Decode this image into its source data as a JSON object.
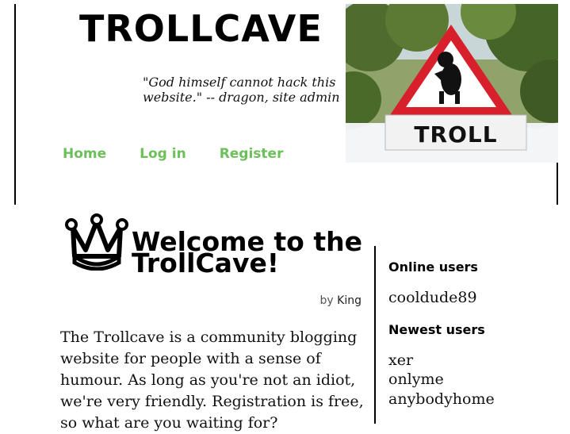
{
  "header": {
    "site_title": "TROLLCAVE",
    "tagline": "\"God himself cannot hack this website.\" -- dragon, site admin",
    "photo_sign_text": "TROLL",
    "nav": [
      {
        "label": "Home"
      },
      {
        "label": "Log in"
      },
      {
        "label": "Register"
      }
    ],
    "nav_color": "#6cc05a"
  },
  "main": {
    "icon": "crown-icon",
    "welcome_title": "Welcome to the TrollCave!",
    "byline_prefix": "by",
    "byline_author": "King",
    "intro_text": "The Trollcave is a community blogging website for people with a sense of humour. As long as you're not an idiot, we're very friendly. Registration is free, so what are you waiting for?"
  },
  "sidebar": {
    "online_heading": "Online users",
    "online_users": [
      "cooldude89"
    ],
    "newest_heading": "Newest users",
    "newest_users": [
      "xer",
      "onlyme",
      "anybodyhome"
    ]
  }
}
